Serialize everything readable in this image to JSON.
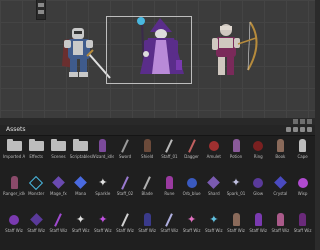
{
  "scene": {
    "characters": [
      {
        "name": "knight",
        "colors": {
          "armor": "#3f5b8c",
          "cape": "#6a2f2f",
          "metal": "#c9c9c9"
        }
      },
      {
        "name": "mage",
        "colors": {
          "robe": "#5a2d8a",
          "trim": "#b98ad8",
          "skin": "#dcdcdc"
        }
      },
      {
        "name": "archer",
        "colors": {
          "tunic": "#7a2a5a",
          "armor": "#d0c8c0",
          "bow": "#b68b3c"
        }
      }
    ]
  },
  "panel": {
    "tab_label": "Assets"
  },
  "assets": {
    "row1": [
      {
        "label": "Imported Assets",
        "icon": "folder-icon",
        "color": "#bdbdbd"
      },
      {
        "label": "Effects",
        "icon": "folder-icon",
        "color": "#bdbdbd"
      },
      {
        "label": "Scenes",
        "icon": "folder-icon",
        "color": "#bdbdbd"
      },
      {
        "label": "Scriptables",
        "icon": "folder-icon",
        "color": "#bdbdbd"
      },
      {
        "label": "Wizard_idle",
        "icon": "figure-icon",
        "color": "#7b4a9a"
      },
      {
        "label": "Sword",
        "icon": "stick-icon",
        "color": "#9a9a9a"
      },
      {
        "label": "Shield",
        "icon": "figure-icon",
        "color": "#6b4a3a"
      },
      {
        "label": "Staff_01",
        "icon": "stick-icon",
        "color": "#b9b9b9"
      },
      {
        "label": "Dagger",
        "icon": "stick-icon",
        "color": "#c06060"
      },
      {
        "label": "Amulet",
        "icon": "orb-icon",
        "color": "#a03030"
      },
      {
        "label": "Potion",
        "icon": "figure-icon",
        "color": "#8a5a9a"
      },
      {
        "label": "Ring",
        "icon": "orb-icon",
        "color": "#7a2020"
      },
      {
        "label": "Book",
        "icon": "figure-icon",
        "color": "#8a6a5a"
      },
      {
        "label": "Cape",
        "icon": "figure-icon",
        "color": "#bdbdbd"
      }
    ],
    "row2": [
      {
        "label": "Ranger_idle",
        "icon": "figure-icon",
        "color": "#8a4a6a"
      },
      {
        "label": "Monster",
        "icon": "cube-icon",
        "color": "#49b8e0"
      },
      {
        "label": "Mage_fx",
        "icon": "gem-icon",
        "color": "#6a4ab0"
      },
      {
        "label": "Mana",
        "icon": "gem-icon",
        "color": "#4a6ae0"
      },
      {
        "label": "Sparkle",
        "icon": "star-icon",
        "color": "#e0e0e0"
      },
      {
        "label": "Staff_02",
        "icon": "stick-icon",
        "color": "#9a7ad0"
      },
      {
        "label": "Blade",
        "icon": "stick-icon",
        "color": "#b0b0b0"
      },
      {
        "label": "Rune",
        "icon": "figure-icon",
        "color": "#9a3aa0"
      },
      {
        "label": "Orb_blue",
        "icon": "orb-icon",
        "color": "#3a5ac0"
      },
      {
        "label": "Shard",
        "icon": "gem-icon",
        "color": "#7a5ab0"
      },
      {
        "label": "Spark_01",
        "icon": "star-icon",
        "color": "#c0c0e0"
      },
      {
        "label": "Glow",
        "icon": "orb-icon",
        "color": "#5a3a9a"
      },
      {
        "label": "Crystal",
        "icon": "gem-icon",
        "color": "#4a4ac0"
      },
      {
        "label": "Wisp",
        "icon": "orb-icon",
        "color": "#b04ad0"
      }
    ],
    "row3": [
      {
        "label": "Staff Wiz",
        "icon": "orb-icon",
        "color": "#7a3ab0"
      },
      {
        "label": "Staff Wiz",
        "icon": "gem-icon",
        "color": "#5a3a9a"
      },
      {
        "label": "Staff Wiz",
        "icon": "stick-icon",
        "color": "#a04ad0"
      },
      {
        "label": "Staff Wiz",
        "icon": "star-icon",
        "color": "#e0e0e0"
      },
      {
        "label": "Staff Wiz",
        "icon": "star-icon",
        "color": "#c050e0"
      },
      {
        "label": "Staff Wiz",
        "icon": "stick-icon",
        "color": "#d0d0d0"
      },
      {
        "label": "Staff Wiz",
        "icon": "figure-icon",
        "color": "#3a3a8a"
      },
      {
        "label": "Staff Wiz",
        "icon": "stick-icon",
        "color": "#b0b0e0"
      },
      {
        "label": "Staff Wiz",
        "icon": "star-icon",
        "color": "#e070c0"
      },
      {
        "label": "Staff Wiz",
        "icon": "star-icon",
        "color": "#60c0e0"
      },
      {
        "label": "Staff Wiz",
        "icon": "figure-icon",
        "color": "#8a6a5a"
      },
      {
        "label": "Staff Wiz",
        "icon": "figure-icon",
        "color": "#7a3ab0"
      },
      {
        "label": "Staff Wiz",
        "icon": "figure-icon",
        "color": "#aa5a8a"
      },
      {
        "label": "Staff Wiz",
        "icon": "figure-icon",
        "color": "#6a2a7a"
      }
    ]
  }
}
